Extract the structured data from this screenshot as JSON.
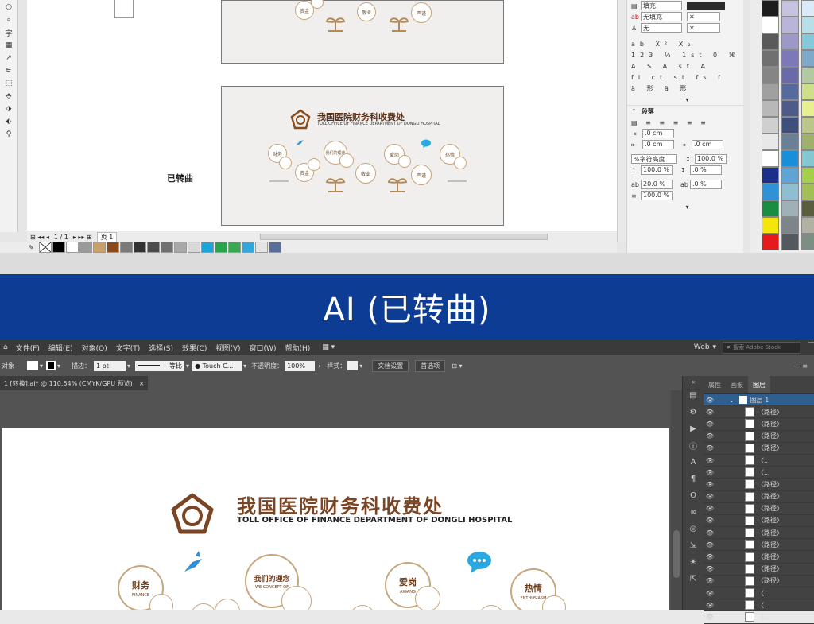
{
  "corel": {
    "tools": [
      "○",
      "⌕",
      "字",
      "▦",
      "↗",
      "⚟",
      "⬚",
      "⬘",
      "⬗",
      "⬖",
      "⚲"
    ],
    "side_label": "已转曲",
    "card": {
      "title": "我国医院财务科收费处",
      "subtitle": "TOLL OFFICE OF FINANCE DEPARTMENT OF DONGLI HOSPITAL",
      "bubbles": [
        "财务",
        "我们的理念",
        "爱岗",
        "热情",
        "资金",
        "敬业",
        "严谨"
      ]
    },
    "top_card_bubbles": [
      "资金",
      "敬业",
      "严谨"
    ],
    "status": {
      "page_counter": "1 / 1",
      "page_tab": "页 1"
    },
    "bottom_palette": [
      "#000000",
      "#ffffff",
      "#9a9a9a",
      "#c8a06a",
      "#8b4a1a",
      "#7a7a7a",
      "#333333",
      "#4b4b4b",
      "#707070",
      "#a8a8a8",
      "#d8d8d8",
      "#1ca3d8",
      "#2aa44b",
      "#3aa84f",
      "#30a6dc",
      "#e4e4e4",
      "#5a6e9c"
    ],
    "panel": {
      "fill_top": "填充",
      "row_fill": "无填充",
      "row_none": "无",
      "para_header": "段落",
      "indent_1": ".0 cm",
      "indent_2": ".0 cm",
      "indent_3": ".0 cm",
      "line_spacing_mode": "%字符高度",
      "ls1": "100.0 %",
      "ls2": "100.0 %",
      "ls3": ".0 %",
      "ls4": "20.0 %",
      "ls5": ".0 %",
      "ls6": "100.0 %",
      "ls7": ".0 %"
    },
    "right_palette": [
      [
        "#1d1d1d",
        "#c6c3e0",
        "#d9eafb"
      ],
      [
        "#ffffff",
        "#b8b5d8",
        "#b8dfe8"
      ],
      [
        "#5a5a5a",
        "#9c98c8",
        "#84c8d9"
      ],
      [
        "#707070",
        "#7d78b9",
        "#7fa9c8"
      ],
      [
        "#858585",
        "#6a6aa8",
        "#b3c9a1"
      ],
      [
        "#a0a0a0",
        "#566a9e",
        "#cde089"
      ],
      [
        "#b8b8b8",
        "#4e5b8a",
        "#e7ef8e"
      ],
      [
        "#cfcfcf",
        "#3f4f7c",
        "#bcc68a"
      ],
      [
        "#e8e8e8",
        "#6b7f97",
        "#9fb06b"
      ],
      [
        "#ffffff",
        "#1a8fd9",
        "#83c8cf"
      ],
      [
        "#1b2e8a",
        "#5ea5d6",
        "#a3d04b"
      ],
      [
        "#2f92d6",
        "#8fbdd1",
        "#a2bf56"
      ],
      [
        "#198e43",
        "#9fb0b7",
        "#5a5e3e"
      ],
      [
        "#f4e60a",
        "#7d858a",
        "#b2b2a4"
      ],
      [
        "#e41b1b",
        "#535a5f",
        "#7b8f82"
      ]
    ]
  },
  "banner": {
    "title": "AI (已转曲)"
  },
  "ai": {
    "menus": [
      "文件(F)",
      "编辑(E)",
      "对象(O)",
      "文字(T)",
      "选择(S)",
      "效果(C)",
      "视图(V)",
      "窗口(W)",
      "帮助(H)"
    ],
    "workspace": "Web",
    "search_placeholder": "搜索 Adobe Stock",
    "control": {
      "object_label": "对象",
      "stroke_label": "描边：",
      "stroke_value": "1 pt",
      "stroke_style": "等比",
      "brush": "Touch C...",
      "opacity_label": "不透明度：",
      "opacity_value": "100%",
      "style_label": "样式：",
      "doc_setup": "文档设置",
      "prefs": "首选项"
    },
    "doc_tab": "1 [转换].ai* @ 110.54% (CMYK/GPU 预览)",
    "layers": {
      "tabs": [
        "属性",
        "画板",
        "图层"
      ],
      "active_tab": "图层",
      "top_layer": "图层 1",
      "rows": [
        "〈路径〉",
        "〈路径〉",
        "〈路径〉",
        "〈路径〉",
        "〈...",
        "〈...",
        "〈路径〉",
        "〈路径〉",
        "〈路径〉",
        "〈路径〉",
        "〈路径〉",
        "〈路径〉",
        "〈路径〉",
        "〈路径〉",
        "〈路径〉",
        "〈...",
        "〈...",
        "〈..."
      ]
    },
    "artboard": {
      "title": "我国医院财务科收费处",
      "subtitle": "TOLL OFFICE OF FINANCE DEPARTMENT OF DONGLI HOSPITAL",
      "bubbles": [
        {
          "cn": "财务",
          "en": "FINANCE"
        },
        {
          "cn": "我们的理念",
          "en": "WE CONCEPT OF"
        },
        {
          "cn": "爱岗",
          "en": "AIGANG"
        },
        {
          "cn": "热情",
          "en": "ENTHUSIASM"
        }
      ]
    },
    "colors": {
      "brand_brown": "#6b3c1c",
      "gold": "#c8a67c",
      "banner_blue": "#0d3c94",
      "accent_cyan": "#29a9e0"
    }
  }
}
